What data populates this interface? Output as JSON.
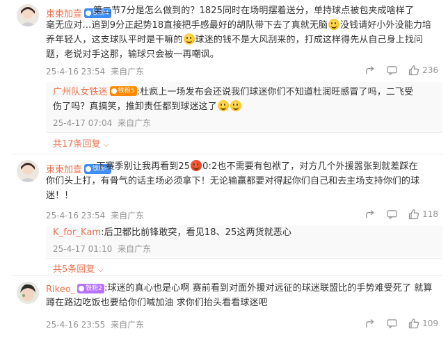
{
  "comments": [
    {
      "user": "東東加壹",
      "badge": "铁粉4",
      "text_lines": [
        "第二节7分是怎么做到的？1825同时在场明摆着送分，单持球点被包夹成啥样了",
        "毫无应对…追到9分正起势18直接把手感最好的胡队带下去了真就无脑",
        "没钱请好小外没能力培",
        "养年轻人，这支球队平时是干嘛的",
        "球迷的钱不是大风刮来的，打成这样得先从自己身上找问",
        "题，老说对手这那，输球只会被一再嘲讽。"
      ],
      "time": "25-4-16 23:54",
      "location": "来自广东",
      "likes": "236",
      "replies": [
        {
          "user": "广州队女铁迷",
          "badge": "铁粉5",
          "text_lines": [
            "杜疯上一场发布会还说我们球迷你们不知道杜润旺感冒了吗，二飞受",
            "伤了吗？真搞笑，推卸责任都到球迷这了"
          ],
          "time": "25-4-17 07:04",
          "location": "来自广东"
        }
      ],
      "more": "共17条回复"
    },
    {
      "user": "東東加壹",
      "badge": "铁粉4",
      "text_lines": [
        "下赛季别让我再看到25",
        "0:2也不需要有包袱了，对方几个外援嚣张到就差踩在",
        "你们头上打，有骨气的话主场必须拿下！无论输赢都要对得起你们自己和去主场支持你们的球",
        "迷！！"
      ],
      "time": "25-4-16 23:54",
      "location": "来自广东",
      "likes": "118",
      "replies": [
        {
          "user": "K_for_Kam",
          "badge": "",
          "text_lines": [
            "后卫都比前锋敢突，看见18、25这两货就恶心"
          ],
          "time": "25-4-17 01:10",
          "location": "来自广东"
        }
      ],
      "more": "共5条回复"
    },
    {
      "user": "Rikeo_",
      "badge": "铁粉2",
      "text_lines": [
        "球迷的真心也是心啊 赛前看到对面外援对远征的球迷联盟比的手势难受死了 就算",
        "蹲在路边吃饭也要给你们喊加油 求你们抬头看看球迷吧"
      ],
      "time": "25-4-16 23:55",
      "location": "来自广东",
      "likes": "109",
      "replies": []
    }
  ],
  "colors": {
    "username": "#eb7350",
    "meta": "#939393",
    "badge_blue": "#3d8df4"
  },
  "icons": {
    "share": "share-icon",
    "comment": "comment-icon",
    "like": "thumbs-up-icon",
    "more": "chevron-down-icon"
  }
}
